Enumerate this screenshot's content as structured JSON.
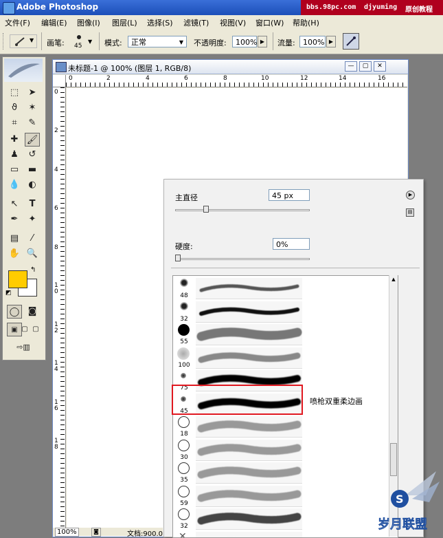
{
  "app": {
    "title": "Adobe Photoshop"
  },
  "watermark": {
    "site": "bbs.98pc.com",
    "user": "djyuming",
    "tag": "原创教程"
  },
  "menu": [
    "文件(F)",
    "编辑(E)",
    "图像(I)",
    "图层(L)",
    "选择(S)",
    "滤镜(T)",
    "视图(V)",
    "窗口(W)",
    "帮助(H)"
  ],
  "options": {
    "brush_label": "画笔:",
    "brush_size": "45",
    "mode_label": "模式:",
    "mode_value": "正常",
    "opacity_label": "不透明度:",
    "opacity_value": "100%",
    "flow_label": "流量:",
    "flow_value": "100%"
  },
  "document": {
    "title": "未标题-1 @ 100% (图层 1, RGB/8)",
    "ruler_top": [
      "0",
      "2",
      "4",
      "6",
      "8",
      "10",
      "12",
      "14",
      "16"
    ],
    "ruler_left": [
      "0",
      "2",
      "4",
      "6",
      "8",
      "1\n0",
      "1\n2",
      "1\n4",
      "1\n6",
      "1\n8"
    ],
    "zoom": "100%",
    "doc_info": "文档:900.0"
  },
  "brush_panel": {
    "diameter_label": "主直径",
    "diameter_value": "45 px",
    "diameter_fraction": 0.22,
    "hardness_label": "硬度:",
    "hardness_value": "0%",
    "hardness_fraction": 0.0,
    "brushes": [
      {
        "size": "48",
        "kind": "splatter"
      },
      {
        "size": "32",
        "kind": "splatter-dark"
      },
      {
        "size": "55",
        "kind": "solid"
      },
      {
        "size": "100",
        "kind": "texture"
      },
      {
        "size": "75",
        "kind": "soft"
      },
      {
        "size": "45",
        "kind": "soft-selected"
      },
      {
        "size": "18",
        "kind": "ring"
      },
      {
        "size": "30",
        "kind": "ring"
      },
      {
        "size": "35",
        "kind": "ring"
      },
      {
        "size": "59",
        "kind": "ring"
      },
      {
        "size": "32",
        "kind": "ring-dark"
      },
      {
        "size": "",
        "kind": "cross"
      }
    ],
    "tooltip": "喷枪双重柔边画"
  },
  "colors": {
    "foreground": "#ffcc00",
    "background": "#ffffff",
    "highlight": "#e01820"
  },
  "watermark_logo": {
    "text": "岁月联盟"
  }
}
